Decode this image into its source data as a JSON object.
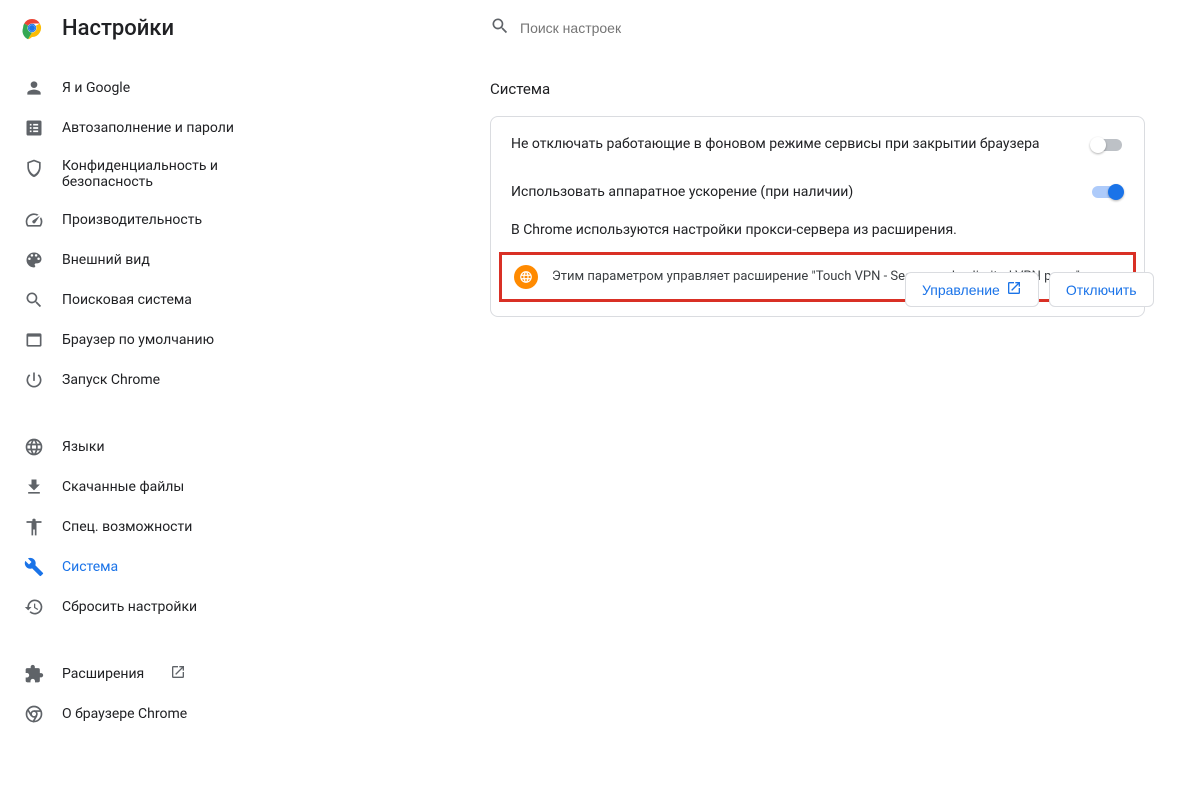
{
  "header": {
    "title": "Настройки",
    "search_placeholder": "Поиск настроек"
  },
  "sidebar": {
    "group1": [
      {
        "label": "Я и Google"
      },
      {
        "label": "Автозаполнение и пароли"
      },
      {
        "label": "Конфиденциальность и безопасность"
      },
      {
        "label": "Производительность"
      },
      {
        "label": "Внешний вид"
      },
      {
        "label": "Поисковая система"
      },
      {
        "label": "Браузер по умолчанию"
      },
      {
        "label": "Запуск Chrome"
      }
    ],
    "group2": [
      {
        "label": "Языки"
      },
      {
        "label": "Скачанные файлы"
      },
      {
        "label": "Спец. возможности"
      },
      {
        "label": "Система"
      },
      {
        "label": "Сбросить настройки"
      }
    ],
    "group3": [
      {
        "label": "Расширения"
      },
      {
        "label": "О браузере Chrome"
      }
    ]
  },
  "main": {
    "section_title": "Система",
    "background_label": "Не отключать работающие в фоновом режиме сервисы при закрытии браузера",
    "hw_accel_label": "Использовать аппаратное ускорение (при наличии)",
    "proxy_note": "В Chrome используются настройки прокси-сервера из расширения.",
    "extension_notice": "Этим параметром управляет расширение \"Touch VPN - Secure and unlimited VPN proxy\"",
    "manage_btn": "Управление",
    "disable_btn": "Отключить"
  }
}
